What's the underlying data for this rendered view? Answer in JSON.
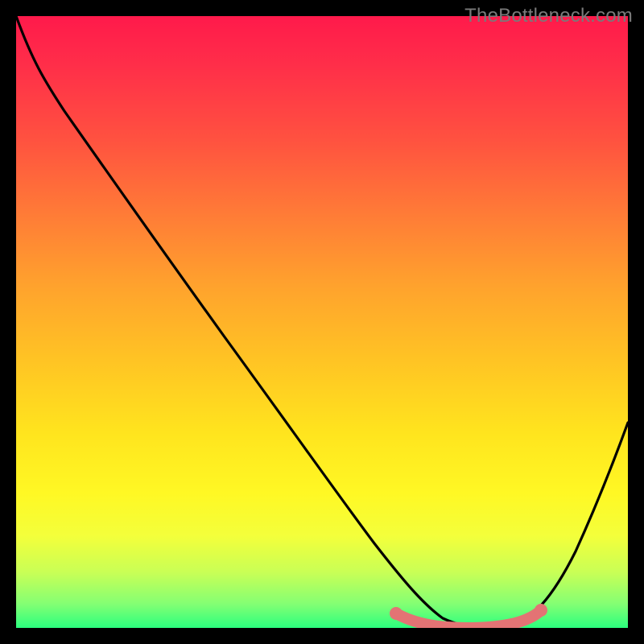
{
  "watermark": "TheBottleneck.com",
  "chart_data": {
    "type": "line",
    "title": "",
    "xlabel": "",
    "ylabel": "",
    "x_range": [
      0,
      100
    ],
    "y_range": [
      0,
      100
    ],
    "series": [
      {
        "name": "black-curve",
        "color": "#000000",
        "x": [
          0,
          4,
          10,
          20,
          30,
          40,
          50,
          57,
          62,
          68,
          73,
          78,
          83,
          88,
          94,
          100
        ],
        "y": [
          100,
          92,
          84,
          71,
          58,
          45,
          32,
          22,
          14,
          6,
          1,
          0,
          0,
          4,
          16,
          34
        ]
      },
      {
        "name": "pink-marker-band",
        "color": "#e37374",
        "x": [
          62,
          65,
          68,
          71,
          74,
          77,
          80,
          83,
          85
        ],
        "y": [
          2.2,
          1.2,
          0.6,
          0.3,
          0.3,
          0.4,
          0.6,
          1.2,
          2.6
        ]
      }
    ],
    "gradient_stops": [
      {
        "pos": 0,
        "color": "#ff1a4b"
      },
      {
        "pos": 8,
        "color": "#ff2e49"
      },
      {
        "pos": 20,
        "color": "#ff5140"
      },
      {
        "pos": 32,
        "color": "#ff7a37"
      },
      {
        "pos": 44,
        "color": "#ffa22d"
      },
      {
        "pos": 56,
        "color": "#ffc324"
      },
      {
        "pos": 68,
        "color": "#ffe41e"
      },
      {
        "pos": 78,
        "color": "#fff824"
      },
      {
        "pos": 85,
        "color": "#f3ff3b"
      },
      {
        "pos": 91,
        "color": "#c8ff56"
      },
      {
        "pos": 96,
        "color": "#85ff73"
      },
      {
        "pos": 100,
        "color": "#2bff7e"
      }
    ]
  }
}
